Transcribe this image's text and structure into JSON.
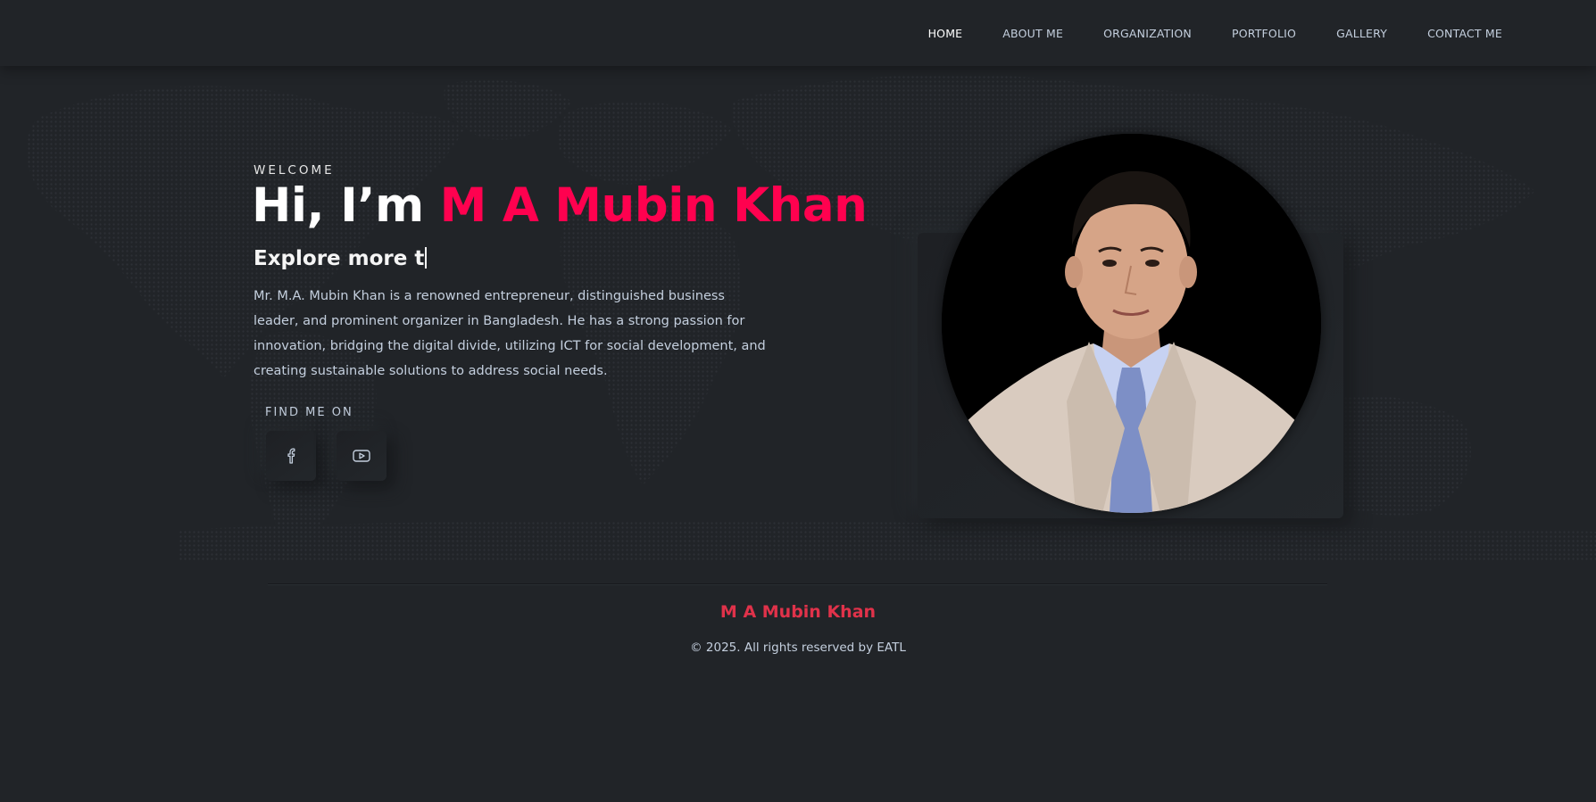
{
  "nav": {
    "items": [
      {
        "label": "HOME",
        "active": true
      },
      {
        "label": "ABOUT ME"
      },
      {
        "label": "ORGANIZATION"
      },
      {
        "label": "PORTFOLIO"
      },
      {
        "label": "GALLERY"
      },
      {
        "label": "CONTACT ME"
      }
    ]
  },
  "hero": {
    "welcome": "WELCOME",
    "greeting": "Hi, I’m ",
    "name": "M A Mubin Khan",
    "typed_text": "Explore more t",
    "bio": "Mr. M.A. Mubin Khan is a renowned entrepreneur, distinguished business leader, and prominent organizer in Bangladesh. He has a strong passion for innovation, bridging the digital divide, utilizing ICT for social development, and creating sustainable solutions to address social needs.",
    "find_me_label": "FIND ME ON",
    "social": [
      {
        "icon": "facebook-icon"
      },
      {
        "icon": "youtube-icon"
      }
    ],
    "photo": {
      "icon": "portrait-photo"
    }
  },
  "footer": {
    "name": "M A Mubin Khan",
    "copyright": "© 2025. All rights reserved by EATL"
  },
  "colors": {
    "background": "#212428",
    "accent": "#ff014f",
    "footer_accent": "#e0324a",
    "text": "#c4cfde",
    "heading": "#ffffff"
  }
}
